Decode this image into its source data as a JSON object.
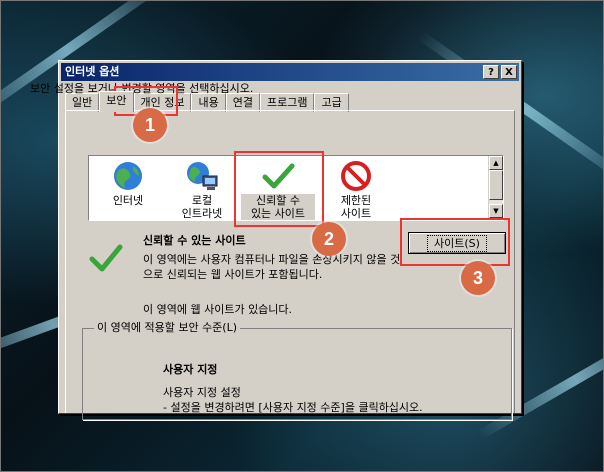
{
  "window": {
    "title": "인터넷 옵션",
    "help_button": "?",
    "close_button": "X"
  },
  "tabs": [
    "일반",
    "보안",
    "개인 정보",
    "내용",
    "연결",
    "프로그램",
    "고급"
  ],
  "active_tab": "보안",
  "security": {
    "instruction": "보안 설정을 보거나 변경할 영역을 선택하십시오.",
    "zones": [
      {
        "label": "인터넷",
        "icon": "globe-icon"
      },
      {
        "label": "로컬\n인트라넷",
        "icon": "intranet-icon"
      },
      {
        "label": "신뢰할 수\n있는 사이트",
        "icon": "checkmark-icon"
      },
      {
        "label": "제한된\n사이트",
        "icon": "restricted-icon"
      }
    ],
    "selected_zone": {
      "title": "신뢰할 수 있는 사이트",
      "description": "이 영역에는 사용자 컴퓨터나 파일을 손상시키지 않을 것으로 신뢰되는 웹 사이트가 포함됩니다.",
      "sites_note": "이 영역에 웹 사이트가 있습니다."
    },
    "sites_button": "사이트(S)",
    "level_group": {
      "label": "이 영역에 적용할 보안 수준(L)",
      "level": "사용자 지정",
      "settings_title": "사용자 지정 설정",
      "settings_hint": "- 설정을 변경하려면 [사용자 지정 수준]을 클릭하십시오."
    }
  },
  "annotations": [
    "1",
    "2",
    "3"
  ],
  "colors": {
    "titlebar_start": "#0a246a",
    "titlebar_end": "#3a6ea5",
    "dialog_face": "#d4d0c8",
    "highlight_box": "#e33333",
    "badge": "#d96a46"
  }
}
